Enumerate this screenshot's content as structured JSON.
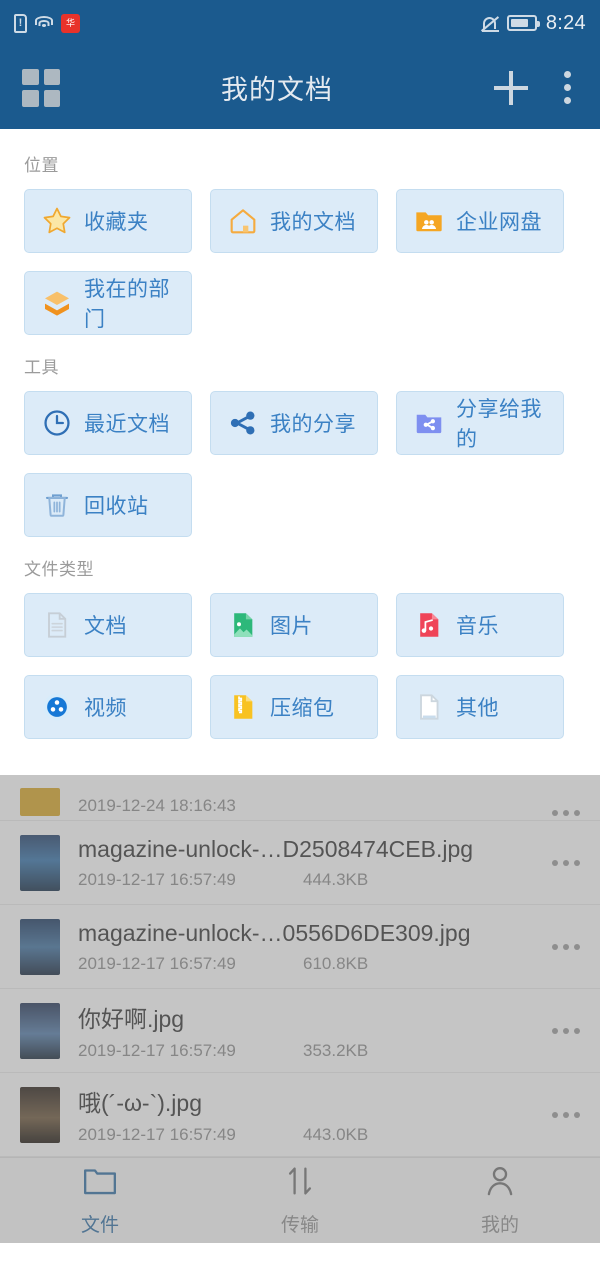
{
  "status_bar": {
    "time": "8:24",
    "icons": [
      "sim-alert-icon",
      "wifi-icon",
      "huawei-badge-icon",
      "silent-bell-icon",
      "battery-icon"
    ],
    "huawei_mark": "华"
  },
  "app_bar": {
    "title": "我的文档",
    "grid_icon": "grid-menu-icon",
    "add_icon": "plus-icon",
    "overflow_icon": "more-vertical-icon"
  },
  "panel": {
    "sections": [
      {
        "label": "位置",
        "items": [
          {
            "label": "收藏夹",
            "icon": "star-icon"
          },
          {
            "label": "我的文档",
            "icon": "home-icon"
          },
          {
            "label": "企业网盘",
            "icon": "team-folder-icon"
          },
          {
            "label": "我在的部门",
            "icon": "layers-icon"
          }
        ]
      },
      {
        "label": "工具",
        "items": [
          {
            "label": "最近文档",
            "icon": "clock-icon"
          },
          {
            "label": "我的分享",
            "icon": "share-nodes-icon"
          },
          {
            "label": "分享给我的",
            "icon": "shared-folder-icon"
          },
          {
            "label": "回收站",
            "icon": "trash-icon"
          }
        ]
      },
      {
        "label": "文件类型",
        "items": [
          {
            "label": "文档",
            "icon": "document-icon"
          },
          {
            "label": "图片",
            "icon": "image-file-icon"
          },
          {
            "label": "音乐",
            "icon": "music-file-icon"
          },
          {
            "label": "视频",
            "icon": "video-reel-icon"
          },
          {
            "label": "压缩包",
            "icon": "zip-file-icon"
          },
          {
            "label": "其他",
            "icon": "blank-file-icon"
          }
        ]
      }
    ]
  },
  "file_list": {
    "partial_row": {
      "date": "2019-12-24 18:16:43"
    },
    "rows": [
      {
        "name": "magazine-unlock-…D2508474CEB.jpg",
        "date": "2019-12-17 16:57:49",
        "size": "444.3KB"
      },
      {
        "name": "magazine-unlock-…0556D6DE309.jpg",
        "date": "2019-12-17 16:57:49",
        "size": "610.8KB"
      },
      {
        "name": "你好啊.jpg",
        "date": "2019-12-17 16:57:49",
        "size": "353.2KB"
      },
      {
        "name": "哦(´-ω-`).jpg",
        "date": "2019-12-17 16:57:49",
        "size": "443.0KB"
      }
    ]
  },
  "bottom_nav": {
    "items": [
      {
        "label": "文件",
        "icon": "folder-icon",
        "active": true
      },
      {
        "label": "传输",
        "icon": "transfer-arrows-icon",
        "active": false
      },
      {
        "label": "我的",
        "icon": "person-icon",
        "active": false
      }
    ]
  },
  "colors": {
    "header_blue": "#1b5a8e",
    "chip_bg": "#dcebf8",
    "chip_border": "#c4ddf0",
    "chip_text": "#3b81c4",
    "accent_orange": "#f5a623",
    "active_nav": "#2b6ca3"
  }
}
